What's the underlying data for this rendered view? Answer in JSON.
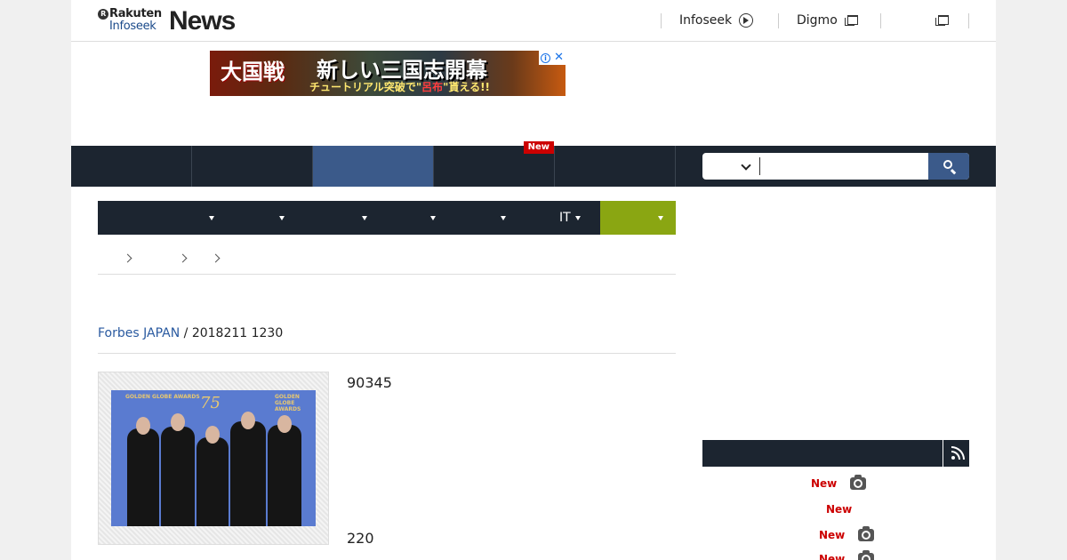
{
  "header": {
    "logo": {
      "brand_top": "Rakuten",
      "brand_sub": "Infoseek",
      "brand_news": "News"
    },
    "links": [
      {
        "label": "Infoseek"
      },
      {
        "label": "Digmo"
      },
      {
        "label": ""
      }
    ]
  },
  "ad": {
    "text_a": "大国戦",
    "text_b": "新しい三国志開幕",
    "text_c_pre": "チュートリアル突破で",
    "text_c_hl": "呂布",
    "text_c_post": "貰える!!"
  },
  "nav": {
    "new_badge": "New",
    "active_tab_index": 2
  },
  "search": {
    "placeholder": "",
    "value": ""
  },
  "subnav": {
    "items": [
      {
        "label": ""
      },
      {
        "label": ""
      },
      {
        "label": ""
      },
      {
        "label": ""
      },
      {
        "label": ""
      },
      {
        "label": "IT"
      },
      {
        "label": ""
      }
    ]
  },
  "article": {
    "source": "Forbes JAPAN",
    "separator": " / ",
    "date": "2018211 1230",
    "number_top": "90345",
    "number_bottom": "220",
    "photo": {
      "logo_text": "75",
      "badge_left": "GOLDEN GLOBE AWARDS",
      "badge_right": "GOLDEN GLOBE AWARDS"
    }
  },
  "ranking": {
    "rows": [
      {
        "badge": "New",
        "icon": "camera-icon"
      },
      {
        "badge": "New",
        "icon": ""
      },
      {
        "badge": "New",
        "icon": "camera-icon"
      },
      {
        "badge": "New",
        "icon": "camera-icon"
      }
    ]
  },
  "colors": {
    "nav_dark": "#1c2530",
    "nav_active": "#3b5a8a",
    "sub_active": "#8aa612",
    "new_red": "#cc0000",
    "link_blue": "#2a5aa0"
  }
}
